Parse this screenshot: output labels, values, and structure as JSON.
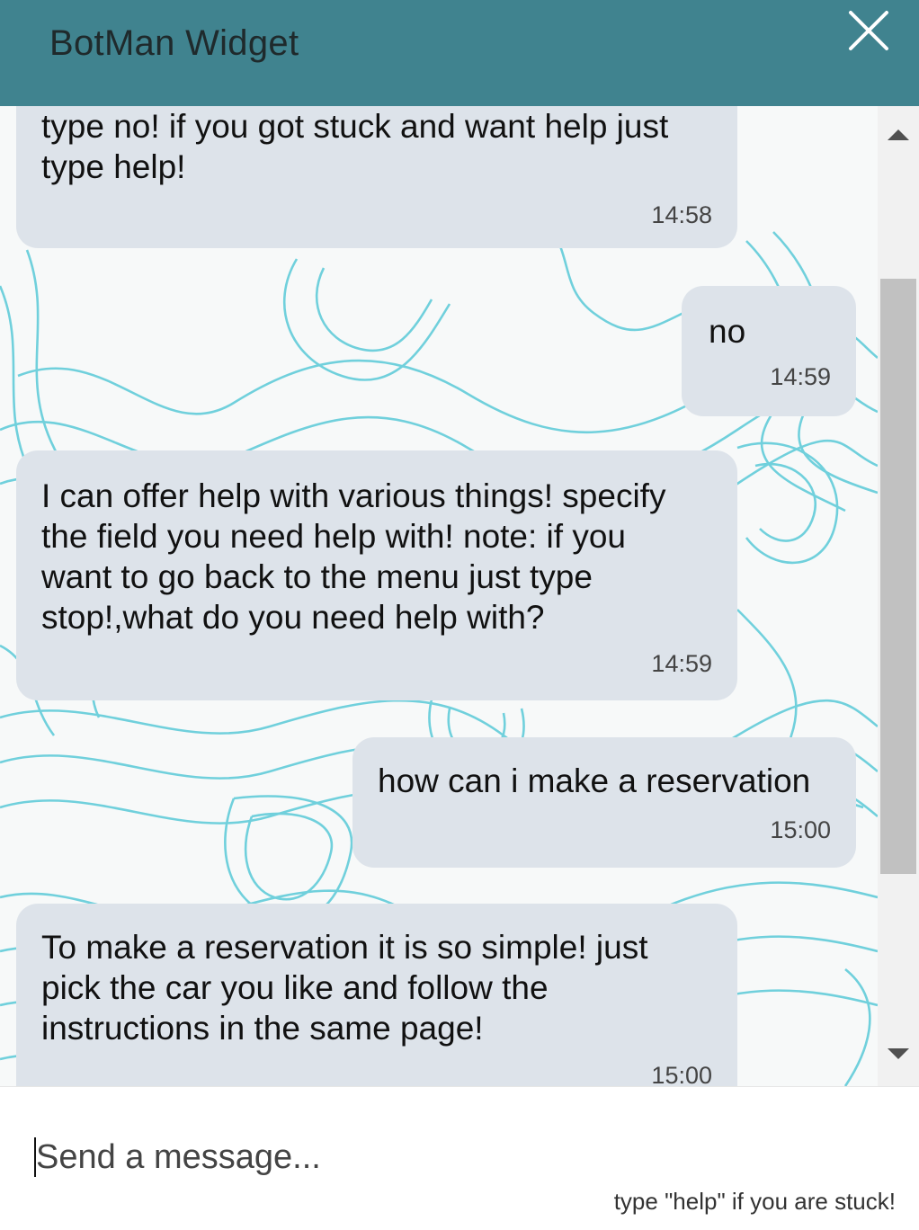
{
  "header": {
    "title": "BotMan Widget",
    "close_icon": "close-icon"
  },
  "messages": [
    {
      "from": "bot",
      "lines": [
        "type no! if you got stuck and want help just",
        "type help!"
      ],
      "time": "14:58"
    },
    {
      "from": "user",
      "lines": [
        "no"
      ],
      "time": "14:59"
    },
    {
      "from": "bot",
      "lines": [
        "I can offer help with various things! specify",
        "the field you need help with! note: if you",
        "want to go back to the menu just type",
        "stop!,what do you need help with?"
      ],
      "time": "14:59"
    },
    {
      "from": "user",
      "lines": [
        "how can i make a reservation"
      ],
      "time": "15:00"
    },
    {
      "from": "bot",
      "lines": [
        "To make a reservation it is so simple! just",
        "pick the car you like and follow the",
        "instructions in the same page!"
      ],
      "time": "15:00"
    }
  ],
  "input": {
    "placeholder": "Send a message...",
    "hint": "type \"help\" if you are stuck!"
  },
  "colors": {
    "header": "#40838f",
    "bubble": "#dde3ea",
    "pattern": "#62ccd9"
  }
}
